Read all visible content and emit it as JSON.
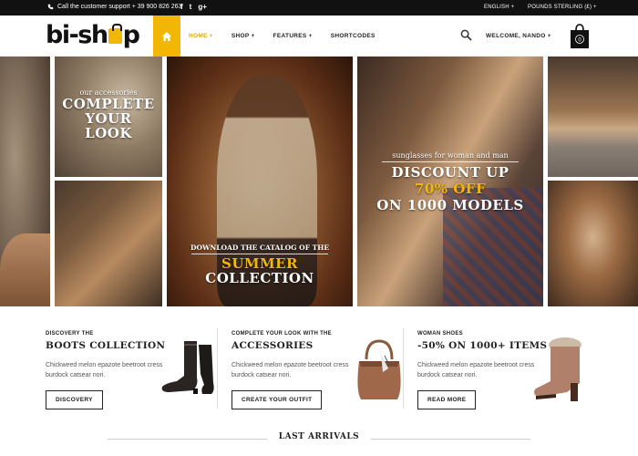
{
  "topbar": {
    "phone_text": "Call the customer support + 39 900 826 263",
    "social": [
      "f",
      "t",
      "g+"
    ],
    "language": "ENGLISH +",
    "currency": "POUNDS STERLING (£) +"
  },
  "header": {
    "logo_left": "bi-sh",
    "logo_right": "p",
    "nav": [
      "HOME +",
      "SHOP +",
      "FEATURES +",
      "SHORTCODES"
    ],
    "welcome": "WELCOME, NANDO +",
    "cart_count": "0"
  },
  "banners": {
    "accessories": {
      "small": "our accessories",
      "big": [
        "COMPLETE",
        "YOUR",
        "LOOK"
      ]
    },
    "catalog": {
      "small": "DOWNLOAD THE CATALOG OF THE",
      "highlight": "SUMMER",
      "big": "COLLECTION"
    },
    "discount": {
      "small": "sunglasses for woman and man",
      "line1": "DISCOUNT UP",
      "highlight": "70% OFF",
      "line3": "ON 1000 MODELS"
    }
  },
  "features": [
    {
      "kicker": "DISCOVERY THE",
      "title": "BOOTS COLLECTION",
      "desc": "Chickweed melon epazote beetroot cress burdock catsear nori.",
      "button": "DISCOVERY"
    },
    {
      "kicker": "COMPLETE YOUR LOOK WITH THE",
      "title": "ACCESSORIES",
      "desc": "Chickweed melon epazote beetroot cress burdock catsear nori.",
      "button": "CREATE YOUR OUTFIT"
    },
    {
      "kicker": "WOMAN SHOES",
      "title": "-50% ON 1000+ ITEMS",
      "desc": "Chickweed melon epazote beetroot cress burdock catsear nori.",
      "button": "READ MORE"
    }
  ],
  "section_title": "LAST ARRIVALS",
  "colors": {
    "accent": "#f2b705",
    "topbar": "#111111"
  }
}
